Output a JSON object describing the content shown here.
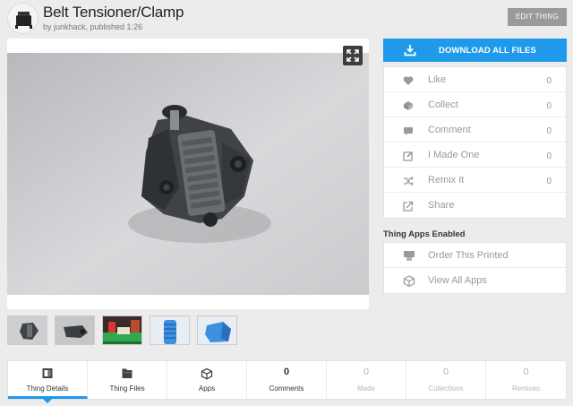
{
  "header": {
    "title": "Belt Tensioner/Clamp",
    "byline": "by junkhack, published 1:26",
    "edit_label": "EDIT THING"
  },
  "download": {
    "label": "DOWNLOAD ALL FILES",
    "icon": "download-tray-icon"
  },
  "actions": [
    {
      "label": "Like",
      "count": "0",
      "icon": "heart-icon"
    },
    {
      "label": "Collect",
      "count": "0",
      "icon": "collect-icon"
    },
    {
      "label": "Comment",
      "count": "0",
      "icon": "comment-icon"
    },
    {
      "label": "I Made One",
      "count": "0",
      "icon": "pencil-square-icon"
    },
    {
      "label": "Remix It",
      "count": "0",
      "icon": "shuffle-icon"
    },
    {
      "label": "Share",
      "count": "",
      "icon": "share-icon"
    }
  ],
  "apps": {
    "heading": "Thing Apps Enabled",
    "items": [
      {
        "label": "Order This Printed",
        "icon": "printer-icon"
      },
      {
        "label": "View All Apps",
        "icon": "cube-icon"
      }
    ]
  },
  "tabs": [
    {
      "label": "Thing Details",
      "count": "",
      "icon": "details-icon"
    },
    {
      "label": "Thing Files",
      "count": "",
      "icon": "folder-icon"
    },
    {
      "label": "Apps",
      "count": "",
      "icon": "cube-icon"
    },
    {
      "label": "Comments",
      "count": "0"
    },
    {
      "label": "Made",
      "count": "0"
    },
    {
      "label": "Collections",
      "count": "0"
    },
    {
      "label": "Remixes",
      "count": "0"
    }
  ],
  "colors": {
    "accent": "#1f9aea",
    "edit_button": "#9a9a9a",
    "muted_text": "#9a9a9a"
  }
}
